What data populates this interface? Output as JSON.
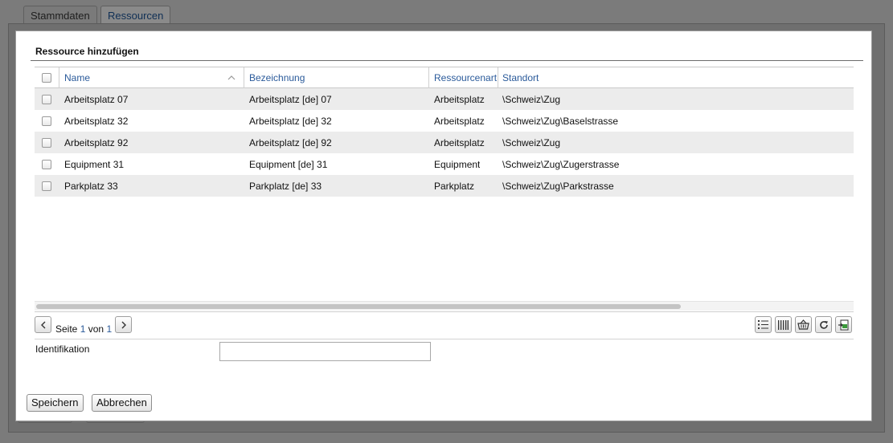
{
  "tabs": [
    {
      "label": "Stammdaten",
      "active": false
    },
    {
      "label": "Ressourcen",
      "active": true
    }
  ],
  "dialog": {
    "title": "Ressource hinzufügen",
    "columns": [
      "Name",
      "Bezeichnung",
      "Ressourcenart",
      "Standort"
    ],
    "rows": [
      {
        "name": "Arbeitsplatz 07",
        "bezeichnung": "Arbeitsplatz [de] 07",
        "art": "Arbeitsplatz",
        "standort": "\\Schweiz\\Zug"
      },
      {
        "name": "Arbeitsplatz 32",
        "bezeichnung": "Arbeitsplatz [de] 32",
        "art": "Arbeitsplatz",
        "standort": "\\Schweiz\\Zug\\Baselstrasse"
      },
      {
        "name": "Arbeitsplatz 92",
        "bezeichnung": "Arbeitsplatz [de] 92",
        "art": "Arbeitsplatz",
        "standort": "\\Schweiz\\Zug"
      },
      {
        "name": "Equipment 31",
        "bezeichnung": "Equipment [de] 31",
        "art": "Equipment",
        "standort": "\\Schweiz\\Zug\\Zugerstrasse"
      },
      {
        "name": "Parkplatz 33",
        "bezeichnung": "Parkplatz [de] 33",
        "art": "Parkplatz",
        "standort": "\\Schweiz\\Zug\\Parkstrasse"
      }
    ],
    "pager": {
      "page_label": "Seite",
      "current": "1",
      "of_label": "von",
      "total": "1"
    },
    "toolbar_icons": [
      "list-icon",
      "columns-icon",
      "basket-icon",
      "refresh-icon",
      "export-icon"
    ],
    "field_label": "Identifikation",
    "field_value": "",
    "save_label": "Speichern",
    "cancel_label": "Abbrechen"
  },
  "colors": {
    "accent": "#2a5a9a",
    "row_alt": "#ececec",
    "overlay": "#7b7b7b"
  }
}
